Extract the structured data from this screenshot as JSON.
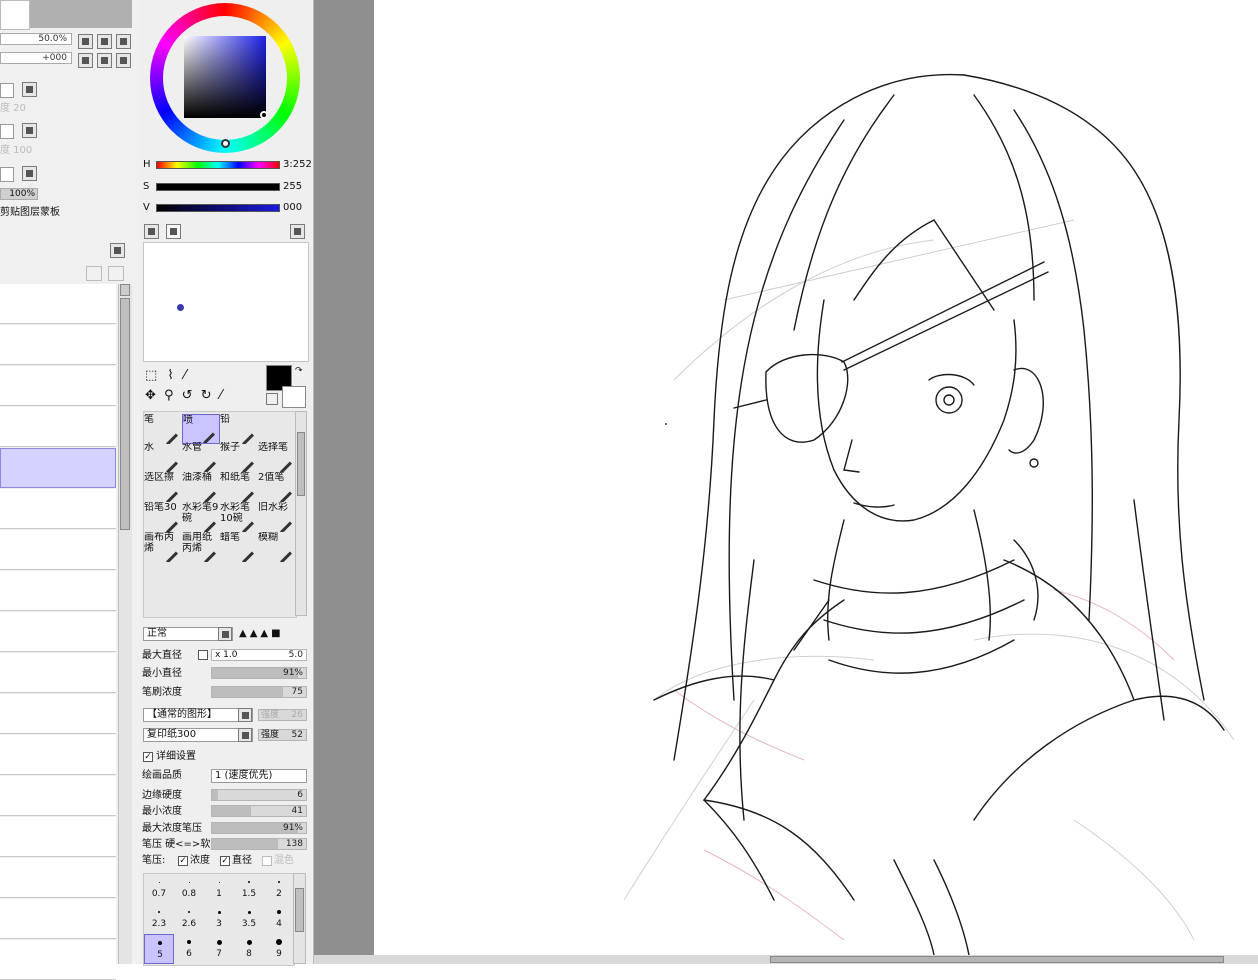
{
  "layer_panel": {
    "zoom_value": "50.0%",
    "rotate_value": "+000",
    "density_label_1": "度 20",
    "density_label_2": "度 100",
    "opacity_value": "100%",
    "clip_mask_label": "剪贴图层蒙板",
    "selected_layer_index": 4
  },
  "color_panel": {
    "h_label": "H",
    "s_label": "S",
    "v_label": "V",
    "h_value": "3:252",
    "s_value": "255",
    "v_value": "000",
    "h_fraction": 0.65,
    "s_fraction": 1.0,
    "v_fraction": 0.0,
    "primary_color": "#000000",
    "secondary_color": "#ffffff",
    "accent": "#3a3ab0"
  },
  "tools": {
    "grid": [
      [
        "笔",
        "喷",
        "铅"
      ],
      [
        "水",
        "水管",
        "猴子",
        "选择笔"
      ],
      [
        "选区擦",
        "油漆桶",
        "和纸笔",
        "2值笔"
      ],
      [
        "铅笔30",
        "水彩笔9碗",
        "水彩笔10碗",
        "旧水彩"
      ],
      [
        "画布丙烯",
        "画用纸丙烯",
        "蜡笔",
        "模糊"
      ]
    ]
  },
  "brush_settings": {
    "blend_mode": "正常",
    "max_size_label": "最大直径",
    "max_size_multiplier": "x 1.0",
    "max_size_value": "5.0",
    "min_size_label": "最小直径",
    "min_size_value": "91%",
    "min_size_fraction": 0.91,
    "density_label": "笔刷浓度",
    "density_value": "75",
    "density_fraction": 0.75,
    "shape_select": "【通常的图形】",
    "shape_strength_label": "强度",
    "shape_strength_value": "26",
    "texture_select": "复印纸300",
    "texture_strength_label": "强度",
    "texture_strength_value": "52",
    "detail_label": "详细设置",
    "quality_label": "绘画品质",
    "quality_value": "1 (速度优先)",
    "edge_label": "边缘硬度",
    "edge_value": "6",
    "edge_fraction": 0.06,
    "min_density_label": "最小浓度",
    "min_density_value": "41",
    "min_density_fraction": 0.41,
    "max_density_pressure_label": "最大浓度笔压",
    "max_density_pressure_value": "91%",
    "max_density_pressure_fraction": 0.91,
    "pressure_label": "笔压 硬<=>软",
    "pressure_value": "138",
    "pressure_fraction": 0.7,
    "pressure_opts_label": "笔压:",
    "pressure_density": "浓度",
    "pressure_size": "直径",
    "pressure_blend": "混色"
  },
  "brush_sizes": {
    "row1": [
      "0.7",
      "0.8",
      "1",
      "1.5",
      "2"
    ],
    "row2": [
      "2.3",
      "2.6",
      "3",
      "3.5",
      "4"
    ],
    "row3": [
      "5",
      "6",
      "7",
      "8",
      "9"
    ]
  }
}
